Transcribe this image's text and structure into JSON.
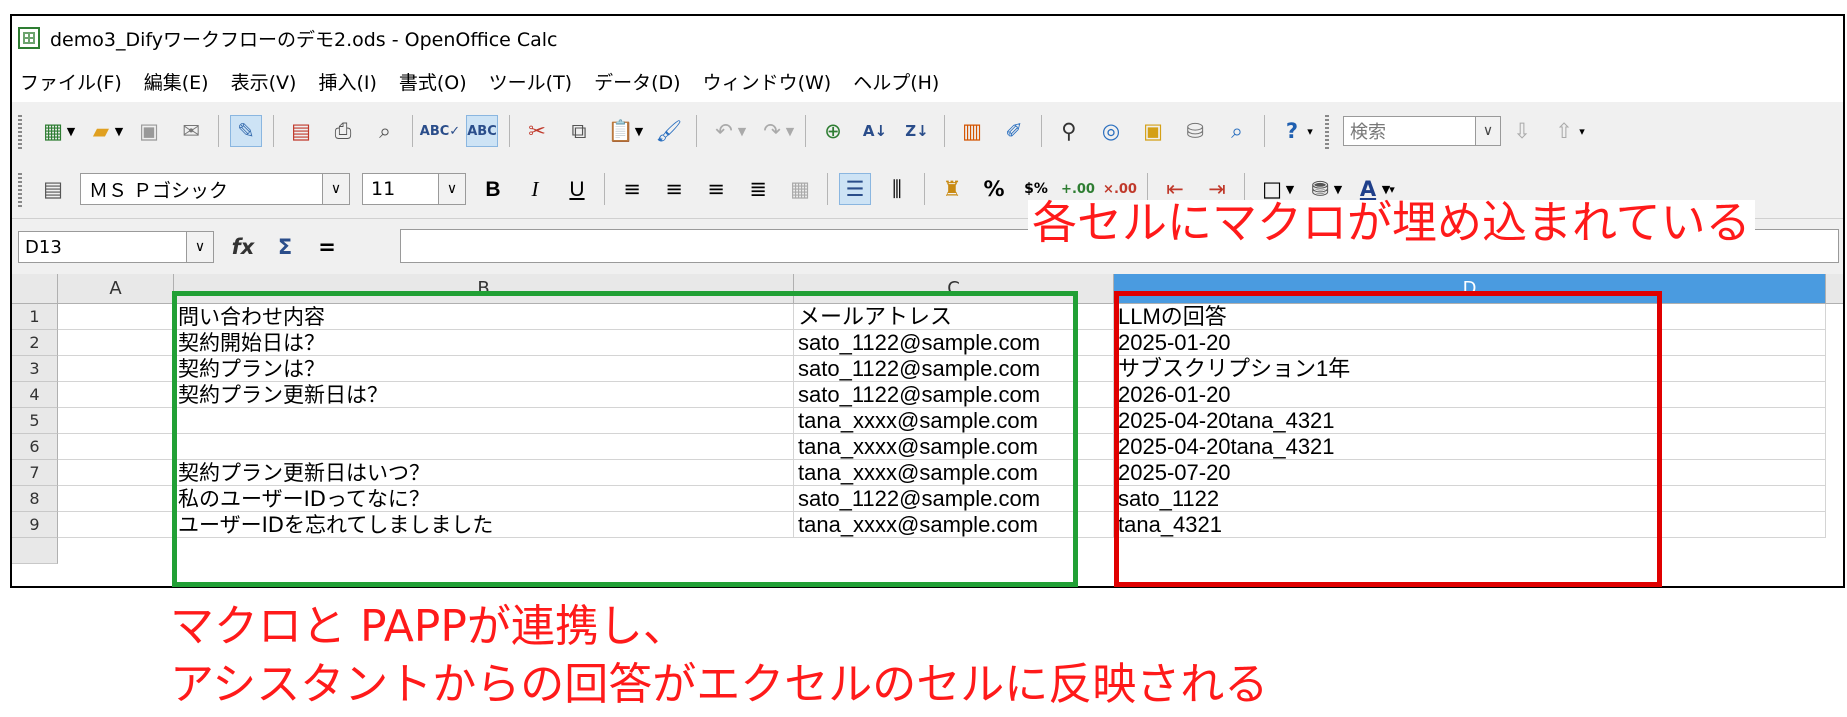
{
  "window": {
    "title": "demo3_Difyワークフローのデモ2.ods - OpenOffice Calc"
  },
  "menu": [
    "ファイル(F)",
    "編集(E)",
    "表示(V)",
    "挿入(I)",
    "書式(O)",
    "ツール(T)",
    "データ(D)",
    "ウィンドウ(W)",
    "ヘルプ(H)"
  ],
  "toolbar1": {
    "search_placeholder": "検索"
  },
  "toolbar2": {
    "font_name": "ＭＳ Ｐゴシック",
    "font_size": "11",
    "bold": "B",
    "italic": "I",
    "underline": "U"
  },
  "formula_bar": {
    "name_box": "D13",
    "fx": "fx",
    "sigma": "Σ",
    "equals": "=",
    "content": ""
  },
  "sheet": {
    "columns": [
      "A",
      "B",
      "C",
      "D"
    ],
    "selected_column": "D",
    "rows": [
      {
        "num": "1",
        "A": "",
        "B": "問い合わせ内容",
        "C": "メールアトレス",
        "D": "LLMの回答"
      },
      {
        "num": "2",
        "A": "",
        "B": "契約開始日は？",
        "C": "sato_1122@sample.com",
        "D": "2025-01-20"
      },
      {
        "num": "3",
        "A": "",
        "B": "契約プランは？",
        "C": "sato_1122@sample.com",
        "D": "サブスクリプション1年"
      },
      {
        "num": "4",
        "A": "",
        "B": "契約プラン更新日は？",
        "C": "sato_1122@sample.com",
        "D": "2026-01-20"
      },
      {
        "num": "5",
        "A": "",
        "B": "",
        "C": "tana_xxxx@sample.com",
        "D": "2025-04-20tana_4321"
      },
      {
        "num": "6",
        "A": "",
        "B": "",
        "C": "tana_xxxx@sample.com",
        "D": "2025-04-20tana_4321"
      },
      {
        "num": "7",
        "A": "",
        "B": "契約プラン更新日はいつ？",
        "C": "tana_xxxx@sample.com",
        "D": "2025-07-20"
      },
      {
        "num": "8",
        "A": "",
        "B": "私のユーザーIDってなに？",
        "C": "sato_1122@sample.com",
        "D": "sato_1122"
      },
      {
        "num": "9",
        "A": "",
        "B": "ユーザーIDを忘れてしましました",
        "C": "tana_xxxx@sample.com",
        "D": "tana_4321"
      }
    ]
  },
  "annotations": {
    "top": "各セルにマクロが埋め込まれている",
    "bottom_line1": "マクロと PAPPが連携し、",
    "bottom_line2": "アシスタントからの回答がエクセルのセルに反映される"
  },
  "colors": {
    "annotation_red": "#ff1a1a",
    "highlight_green": "#21a035",
    "highlight_red": "#e00000",
    "selected_column_header": "#4a9be0"
  }
}
